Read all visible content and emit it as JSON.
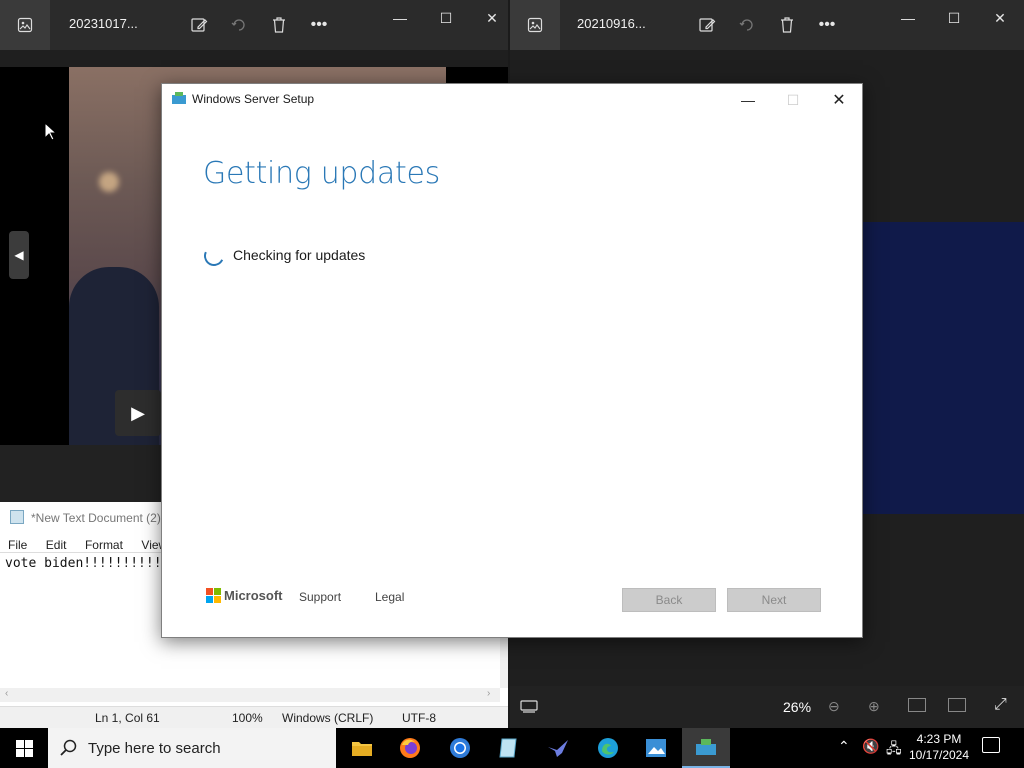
{
  "photo_left": {
    "title": "20231017...",
    "zoom": ""
  },
  "photo_right": {
    "title": "20210916...",
    "zoom": "26%"
  },
  "notepad": {
    "title": "*New Text Document (2)",
    "menu": [
      "File",
      "Edit",
      "Format",
      "View"
    ],
    "content": "vote biden!!!!!!!!!!",
    "status": {
      "position": "Ln 1, Col 61",
      "zoom": "100%",
      "line_ending": "Windows (CRLF)",
      "encoding": "UTF-8"
    }
  },
  "setup": {
    "title": "Windows Server Setup",
    "heading": "Getting updates",
    "status": "Checking for updates",
    "brand": "Microsoft",
    "support": "Support",
    "legal": "Legal",
    "back": "Back",
    "next": "Next"
  },
  "taskbar": {
    "search_placeholder": "Type here to search",
    "time": "4:23 PM",
    "date": "10/17/2024"
  }
}
